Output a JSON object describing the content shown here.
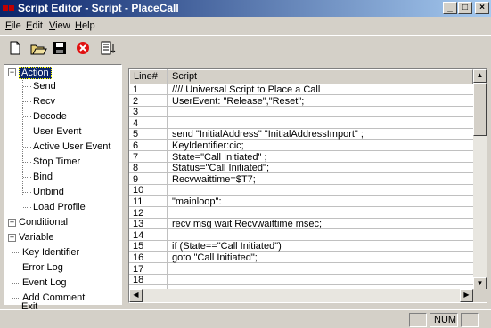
{
  "window": {
    "title": "Script Editor - Script - PlaceCall",
    "minimize": "_",
    "maximize": "□",
    "close": "×"
  },
  "menu": {
    "file": "File",
    "edit": "Edit",
    "view": "View",
    "help": "Help"
  },
  "toolbar": {
    "icons": [
      "new-file-icon",
      "open-folder-icon",
      "save-icon",
      "delete-icon",
      "insert-line-icon"
    ]
  },
  "tree": {
    "action": "Action",
    "action_children": [
      "Send",
      "Recv",
      "Decode",
      "User Event",
      "Active User Event",
      "Stop Timer",
      "Bind",
      "Unbind",
      "Load Profile"
    ],
    "conditional": "Conditional",
    "variable": "Variable",
    "others": [
      "Key Identifier",
      "Error Log",
      "Event Log",
      "Add Comment",
      "Exit"
    ]
  },
  "grid": {
    "col_line": "Line#",
    "col_script": "Script",
    "rows": [
      {
        "n": "1",
        "s": "//// Universal Script to Place a Call"
      },
      {
        "n": "2",
        "s": "UserEvent: \"Release\",\"Reset\";"
      },
      {
        "n": "3",
        "s": ""
      },
      {
        "n": "4",
        "s": ""
      },
      {
        "n": "5",
        "s": "send \"InitialAddress\" \"InitialAddressImport\" ;"
      },
      {
        "n": "6",
        "s": "KeyIdentifier:cic;"
      },
      {
        "n": "7",
        "s": "State=\"Call Initiated\" ;"
      },
      {
        "n": "8",
        "s": "Status=\"Call Initiated\";"
      },
      {
        "n": "9",
        "s": "Recvwaittime=$T7;"
      },
      {
        "n": "10",
        "s": ""
      },
      {
        "n": "11",
        "s": "\"mainloop\":"
      },
      {
        "n": "12",
        "s": ""
      },
      {
        "n": "13",
        "s": "recv msg wait Recvwaittime  msec;"
      },
      {
        "n": "14",
        "s": ""
      },
      {
        "n": "15",
        "s": "if (State==\"Call Initiated\")"
      },
      {
        "n": "16",
        "s": " goto \"Call Initiated\";"
      },
      {
        "n": "17",
        "s": ""
      },
      {
        "n": "18",
        "s": ""
      }
    ]
  },
  "status": {
    "num": "NUM"
  }
}
